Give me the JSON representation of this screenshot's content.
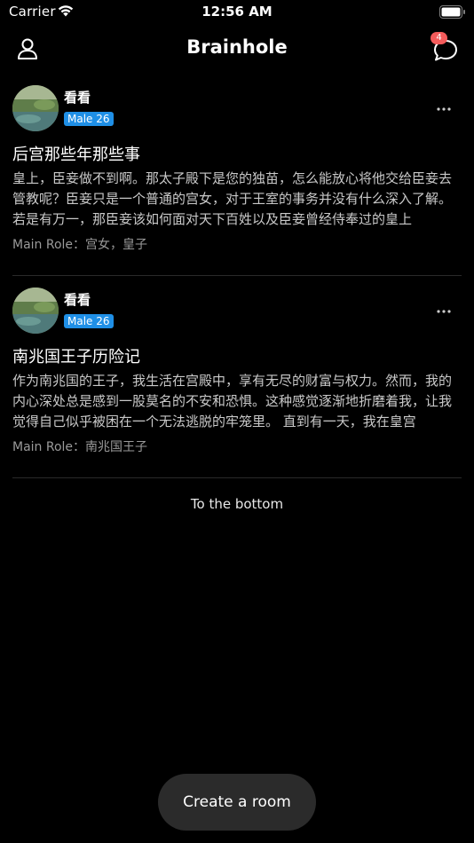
{
  "status_bar": {
    "carrier": "Carrier",
    "time": "12:56 AM",
    "icons": [
      "wifi-icon",
      "battery-icon"
    ]
  },
  "header": {
    "title": "Brainhole",
    "left_icon": "user-icon",
    "right_icon": "chat-bubble-icon",
    "notification_count": "4"
  },
  "posts": [
    {
      "author": "看看",
      "gender_age": "Male 26",
      "title": "后宫那些年那些事",
      "body": "皇上，臣妾做不到啊。那太子殿下是您的独苗，怎么能放心将他交给臣妾去管教呢？臣妾只是一个普通的宫女，对于王室的事务并没有什么深入了解。若是有万一，那臣妾该如何面对天下百姓以及臣妾曾经侍奉过的皇上",
      "main_role": "Main Role：宫女，皇子"
    },
    {
      "author": "看看",
      "gender_age": "Male 26",
      "title": "南兆国王子历险记",
      "body": "作为南兆国的王子，我生活在宫殿中，享有无尽的财富与权力。然而，我的内心深处总是感到一股莫名的不安和恐惧。这种感觉逐渐地折磨着我，让我觉得自己似乎被困在一个无法逃脱的牢笼里。  直到有一天，我在皇宫",
      "main_role": "Main Role：南兆国王子"
    }
  ],
  "list_end_text": "To the bottom",
  "create_room_label": "Create a room",
  "colors": {
    "background": "#000000",
    "badge": "#f45b5b",
    "gender_tag": "#1f8fe6",
    "button": "#2b2b2b"
  }
}
